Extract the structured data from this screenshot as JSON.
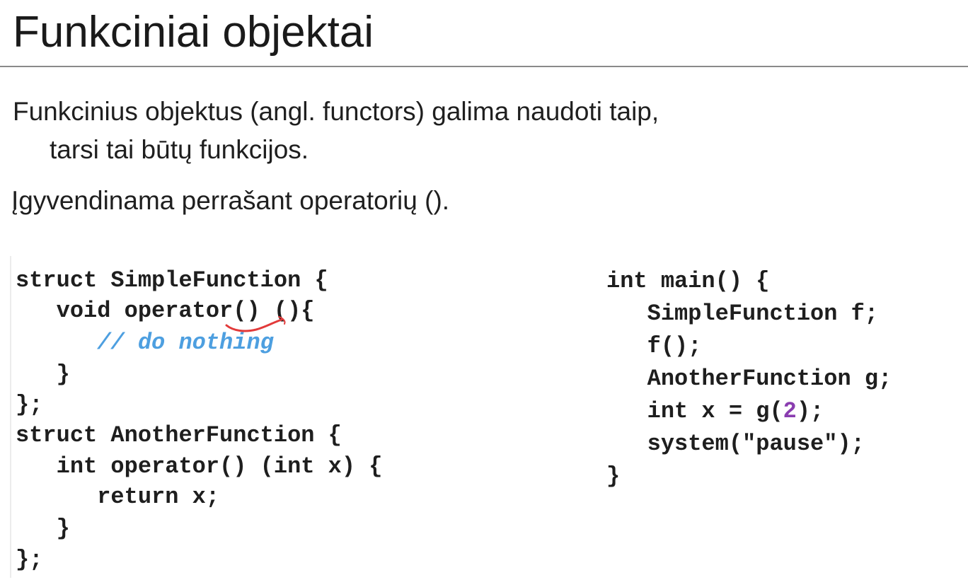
{
  "slide": {
    "title": "Funkciniai objektai",
    "paragraph1_line1": "Funkcinius objektus (angl. functors) galima naudoti taip,",
    "paragraph1_line2": "tarsi tai būtų funkcijos.",
    "paragraph2": "Įgyvendinama perrašant operatorių ()."
  },
  "code_left": [
    "struct SimpleFunction {",
    "   void operator() (){",
    "      // do nothing",
    "   }",
    "};",
    "struct AnotherFunction {",
    "   int operator() (int x) {",
    "      return x;",
    "   }",
    "};"
  ],
  "code_right": {
    "line1": "int main() {",
    "line2": "   SimpleFunction f;",
    "line3": "   f();",
    "line4": "   AnotherFunction g;",
    "line5_prefix": "   int x = g(",
    "line5_number": "2",
    "line5_suffix": ");",
    "line6": "   system(\"pause\");",
    "line7": "}"
  },
  "colors": {
    "comment": "#4d9fe0",
    "number_literal": "#8a3db0",
    "annotation_ink": "#e23a3a"
  }
}
